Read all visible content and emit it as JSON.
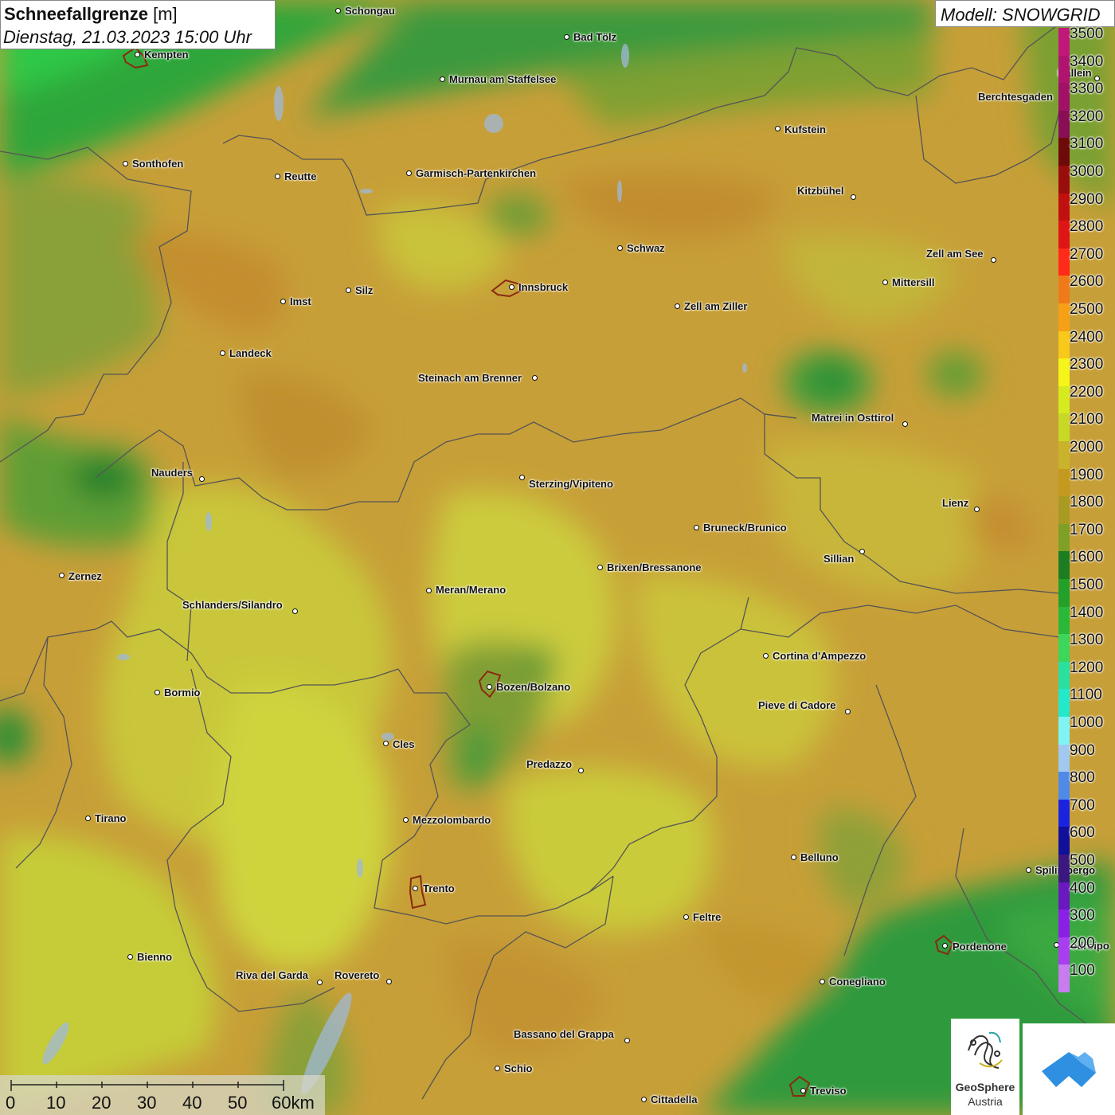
{
  "title": {
    "label": "Schneefallgrenze",
    "unit": "[m]",
    "datetime": "Dienstag, 21.03.2023 15:00 Uhr"
  },
  "model": "Modell: SNOWGRID",
  "legend": {
    "labels": [
      "3500",
      "3400",
      "3300",
      "3200",
      "3100",
      "3000",
      "2900",
      "2800",
      "2700",
      "2600",
      "2500",
      "2400",
      "2300",
      "2200",
      "2100",
      "2000",
      "1900",
      "1800",
      "1700",
      "1600",
      "1500",
      "1400",
      "1300",
      "1200",
      "1100",
      "1000",
      "900",
      "800",
      "700",
      "600",
      "500",
      "400",
      "300",
      "200",
      "100"
    ],
    "colors": [
      "#c2177a",
      "#b01470",
      "#a01167",
      "#8a0d57",
      "#6e0a0a",
      "#9a0d0d",
      "#c01010",
      "#e01515",
      "#ff2a1a",
      "#f07a1a",
      "#f5a017",
      "#f8c81a",
      "#f5f51a",
      "#d5ea1f",
      "#c8d826",
      "#c9b32a",
      "#c3991f",
      "#a89a22",
      "#7fa027",
      "#1c7d22",
      "#22a02a",
      "#29b83a",
      "#3cd65a",
      "#2ae0a0",
      "#24e8cc",
      "#80f4f4",
      "#a0c8f0",
      "#4f8ae8",
      "#1a24e0",
      "#10109a",
      "#3a1880",
      "#6a18c0",
      "#8a20e6",
      "#a83ef0",
      "#c87cf0"
    ]
  },
  "cities": [
    {
      "name": "Schongau",
      "dot": [
        424,
        13
      ],
      "lbl": [
        433,
        7
      ]
    },
    {
      "name": "Bad Tölz",
      "dot": [
        711,
        46
      ],
      "lbl": [
        720,
        40
      ]
    },
    {
      "name": "Kempten",
      "dot": [
        172,
        68
      ],
      "lbl": [
        181,
        62
      ]
    },
    {
      "name": "Murnau am Staffelsee",
      "dot": [
        555,
        99
      ],
      "lbl": [
        564,
        93
      ]
    },
    {
      "name": "Hallein",
      "dot": [
        1377,
        98
      ],
      "lbl": [
        1328,
        85
      ]
    },
    {
      "name": "Berchtesgaden",
      "dot": null,
      "lbl": [
        1228,
        115
      ]
    },
    {
      "name": "Kufstein",
      "dot": [
        976,
        161
      ],
      "lbl": [
        985,
        156
      ]
    },
    {
      "name": "Sonthofen",
      "dot": [
        157,
        205
      ],
      "lbl": [
        166,
        199
      ]
    },
    {
      "name": "Reutte",
      "dot": [
        348,
        221
      ],
      "lbl": [
        357,
        215
      ]
    },
    {
      "name": "Garmisch-Partenkirchen",
      "dot": [
        513,
        217
      ],
      "lbl": [
        522,
        211
      ]
    },
    {
      "name": "Kitzbühel",
      "dot": [
        1071,
        247
      ],
      "lbl": [
        1001,
        233
      ]
    },
    {
      "name": "Schwaz",
      "dot": [
        778,
        311
      ],
      "lbl": [
        787,
        305
      ]
    },
    {
      "name": "Zell am See",
      "dot": [
        1247,
        326
      ],
      "lbl": [
        1163,
        312
      ]
    },
    {
      "name": "Mittersill",
      "dot": [
        1111,
        354
      ],
      "lbl": [
        1120,
        348
      ]
    },
    {
      "name": "Innsbruck",
      "dot": [
        642,
        360
      ],
      "lbl": [
        651,
        354
      ]
    },
    {
      "name": "Silz",
      "dot": [
        437,
        364
      ],
      "lbl": [
        446,
        358
      ]
    },
    {
      "name": "Imst",
      "dot": [
        355,
        378
      ],
      "lbl": [
        364,
        372
      ]
    },
    {
      "name": "Zell am Ziller",
      "dot": [
        850,
        384
      ],
      "lbl": [
        859,
        378
      ]
    },
    {
      "name": "Landeck",
      "dot": [
        279,
        443
      ],
      "lbl": [
        288,
        437
      ]
    },
    {
      "name": "Steinach am Brenner",
      "dot": [
        671,
        474
      ],
      "lbl": [
        525,
        468
      ]
    },
    {
      "name": "Matrei in Osttirol",
      "dot": [
        1136,
        532
      ],
      "lbl": [
        1019,
        518
      ]
    },
    {
      "name": "Nauders",
      "dot": [
        253,
        601
      ],
      "lbl": [
        190,
        587
      ]
    },
    {
      "name": "Sterzing/Vipiteno",
      "dot": [
        655,
        599
      ],
      "lbl": [
        664,
        601
      ]
    },
    {
      "name": "Lienz",
      "dot": [
        1226,
        639
      ],
      "lbl": [
        1183,
        625
      ]
    },
    {
      "name": "Bruneck/Brunico",
      "dot": [
        874,
        662
      ],
      "lbl": [
        883,
        656
      ]
    },
    {
      "name": "Sillian",
      "dot": [
        1082,
        692
      ],
      "lbl": [
        1034,
        695
      ]
    },
    {
      "name": "Brixen/Bressanone",
      "dot": [
        753,
        712
      ],
      "lbl": [
        762,
        706
      ]
    },
    {
      "name": "Zernez",
      "dot": [
        77,
        722
      ],
      "lbl": [
        86,
        717
      ]
    },
    {
      "name": "Meran/Merano",
      "dot": [
        538,
        741
      ],
      "lbl": [
        547,
        734
      ]
    },
    {
      "name": "Schlanders/Silandro",
      "dot": [
        370,
        767
      ],
      "lbl": [
        229,
        753
      ]
    },
    {
      "name": "Cortina d'Ampezzo",
      "dot": [
        961,
        823
      ],
      "lbl": [
        970,
        817
      ]
    },
    {
      "name": "Bozen/Bolzano",
      "dot": [
        614,
        862
      ],
      "lbl": [
        623,
        856
      ]
    },
    {
      "name": "Bormio",
      "dot": [
        197,
        869
      ],
      "lbl": [
        206,
        863
      ]
    },
    {
      "name": "Pieve di Cadore",
      "dot": [
        1064,
        893
      ],
      "lbl": [
        952,
        879
      ]
    },
    {
      "name": "Cles",
      "dot": [
        484,
        933
      ],
      "lbl": [
        493,
        928
      ]
    },
    {
      "name": "Predazzo",
      "dot": [
        729,
        967
      ],
      "lbl": [
        661,
        953
      ]
    },
    {
      "name": "Tirano",
      "dot": [
        110,
        1027
      ],
      "lbl": [
        119,
        1021
      ]
    },
    {
      "name": "Mezzolombardo",
      "dot": [
        509,
        1029
      ],
      "lbl": [
        518,
        1023
      ]
    },
    {
      "name": "Belluno",
      "dot": [
        996,
        1076
      ],
      "lbl": [
        1005,
        1070
      ]
    },
    {
      "name": "Spilimbergo",
      "dot": [
        1291,
        1092
      ],
      "lbl": [
        1300,
        1086
      ]
    },
    {
      "name": "Trento",
      "dot": [
        521,
        1115
      ],
      "lbl": [
        531,
        1109
      ]
    },
    {
      "name": "Feltre",
      "dot": [
        861,
        1151
      ],
      "lbl": [
        870,
        1145
      ]
    },
    {
      "name": "Pordenone",
      "dot": [
        1186,
        1187
      ],
      "lbl": [
        1196,
        1182
      ]
    },
    {
      "name": "Codroipo",
      "dot": [
        1326,
        1186
      ],
      "lbl": [
        1335,
        1181
      ]
    },
    {
      "name": "Bienno",
      "dot": [
        163,
        1201
      ],
      "lbl": [
        172,
        1195
      ]
    },
    {
      "name": "Riva del Garda",
      "dot": [
        401,
        1233
      ],
      "lbl": [
        296,
        1218
      ]
    },
    {
      "name": "Rovereto",
      "dot": [
        488,
        1232
      ],
      "lbl": [
        420,
        1218
      ]
    },
    {
      "name": "Conegliano",
      "dot": [
        1032,
        1232
      ],
      "lbl": [
        1041,
        1226
      ]
    },
    {
      "name": "Bassano del Grappa",
      "dot": [
        787,
        1306
      ],
      "lbl": [
        645,
        1292
      ]
    },
    {
      "name": "Schio",
      "dot": [
        624,
        1341
      ],
      "lbl": [
        633,
        1335
      ]
    },
    {
      "name": "Treviso",
      "dot": [
        1008,
        1369
      ],
      "lbl": [
        1017,
        1363
      ]
    },
    {
      "name": "Cittadella",
      "dot": [
        808,
        1380
      ],
      "lbl": [
        817,
        1374
      ]
    }
  ],
  "scalebar": {
    "ticks": [
      "0",
      "10",
      "20",
      "30",
      "40",
      "50",
      "60km"
    ]
  },
  "logos": {
    "geosphere": "GeoSphere",
    "geosphere_sub": "Austria"
  },
  "colors": {
    "field_main": "#c9a13a",
    "field_yellow": "#cfd13a",
    "field_green": "#2f9a3c",
    "border": "#5a5a5a"
  }
}
